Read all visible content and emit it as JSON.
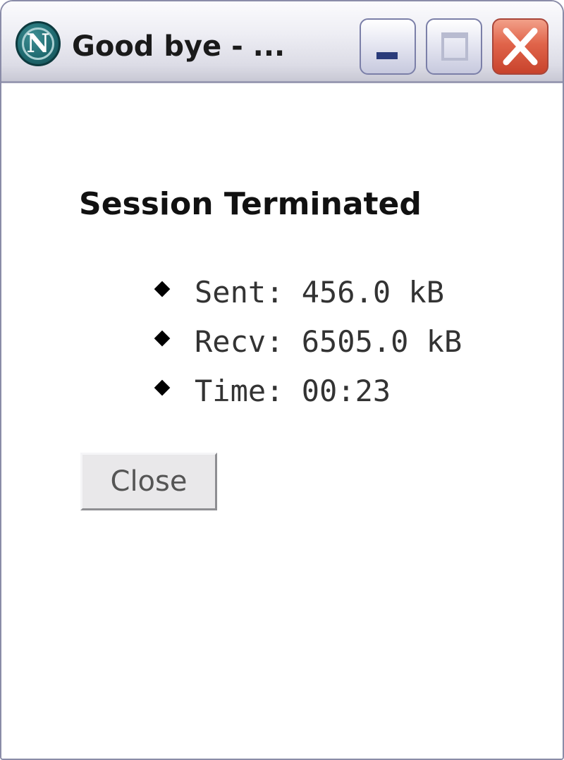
{
  "window": {
    "title": "Good bye - ...",
    "app_icon_letter": "N",
    "controls": {
      "minimize": "minimize-icon",
      "maximize": "maximize-icon",
      "close": "close-icon"
    },
    "close_color": "#d9533a"
  },
  "main": {
    "heading": "Session Terminated",
    "stats": [
      "Sent: 456.0 kB",
      "Recv: 6505.0 kB",
      "Time: 00:23"
    ],
    "close_button_label": "Close"
  }
}
